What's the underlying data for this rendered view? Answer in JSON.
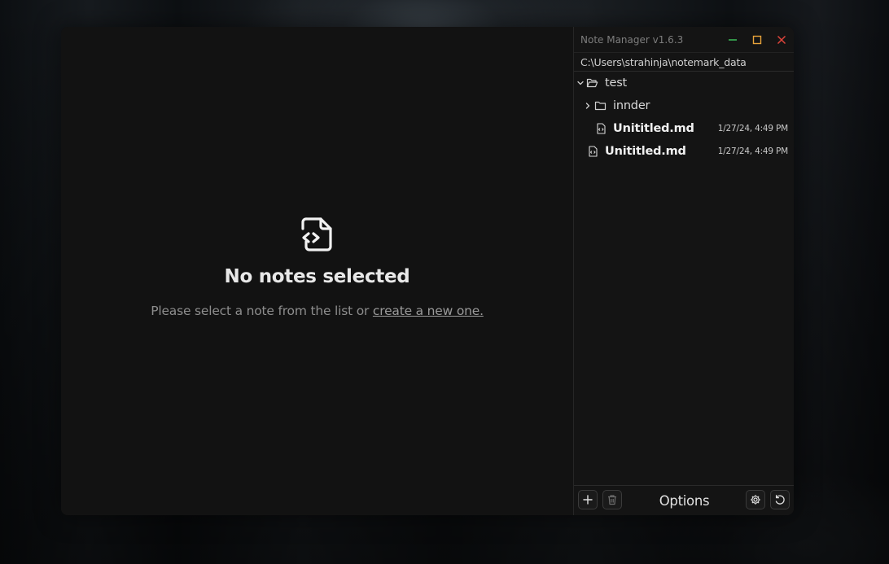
{
  "app": {
    "title": "Note Manager v1.6.3",
    "path": "C:\\Users\\strahinja\\notemark_data"
  },
  "empty_state": {
    "icon": "file-code-icon",
    "title": "No notes selected",
    "subtitle": "Please select a note from the list or",
    "link": "create a new one."
  },
  "tree": {
    "root_folder": {
      "name": "test",
      "icon": "folder-open-icon",
      "expanded": true
    },
    "sub_folder": {
      "name": "innder",
      "icon": "folder-icon",
      "expanded": false
    },
    "nested_file": {
      "name": "Unititled.md",
      "date": "1/27/24, 4:49 PM",
      "icon": "file-code-icon"
    },
    "root_file": {
      "name": "Unititled.md",
      "date": "1/27/24, 4:49 PM",
      "icon": "file-code-icon"
    }
  },
  "footer": {
    "options_label": "Options",
    "buttons": [
      "plus-icon",
      "trash-icon",
      "gear-icon",
      "refresh-icon"
    ]
  },
  "colors": {
    "minimize": "#3dbf5a",
    "maximize": "#e8a33a",
    "close": "#e0443a",
    "panel_bg": "#121212",
    "sidebar_bg": "#141414"
  }
}
